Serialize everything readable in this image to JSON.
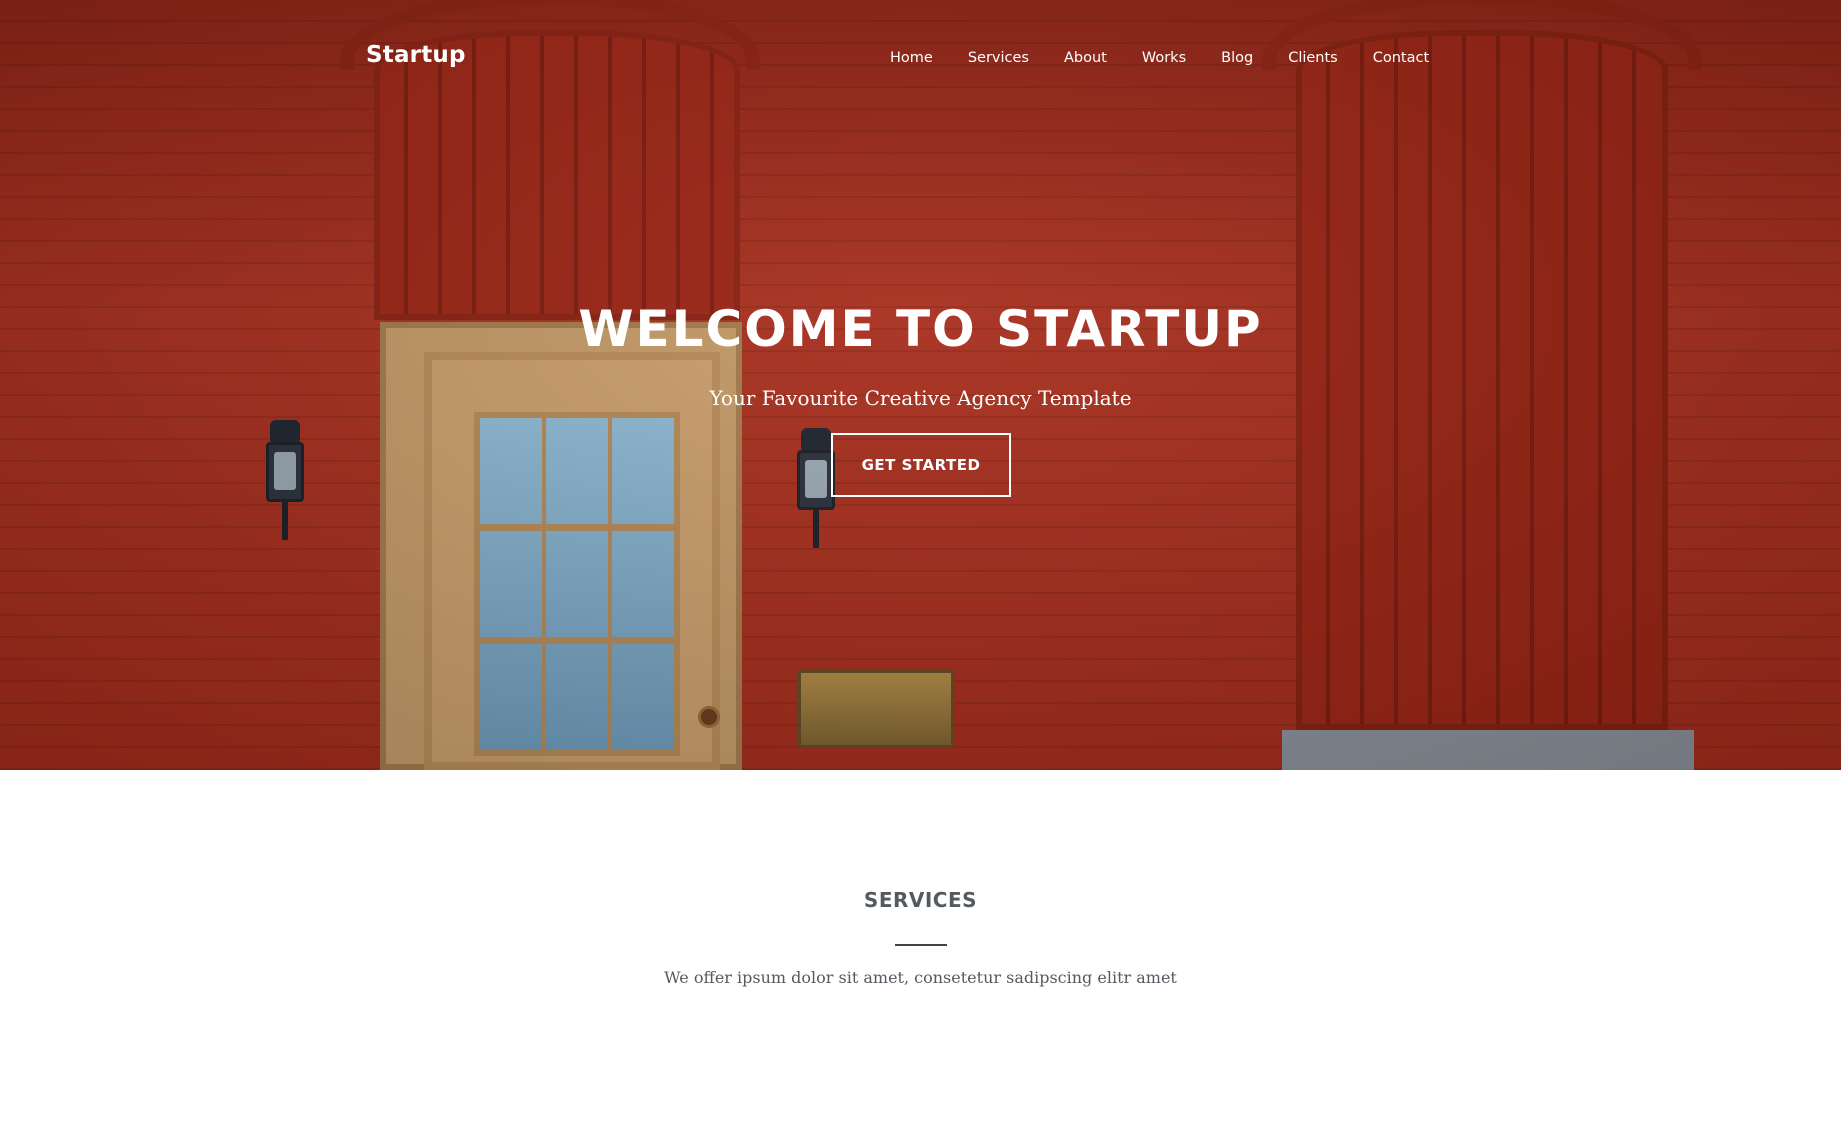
{
  "nav": {
    "brand": "Startup",
    "links": [
      "Home",
      "Services",
      "About",
      "Works",
      "Blog",
      "Clients",
      "Contact"
    ]
  },
  "hero": {
    "title": "WELCOME TO STARTUP",
    "subtitle": "Your Favourite Creative Agency Template",
    "button_label": "GET STARTED",
    "background_image": "red-brick-building-facade"
  },
  "services": {
    "title": "SERVICES",
    "description": "We offer ipsum dolor sit amet, consetetur sadipscing elitr amet"
  },
  "colors": {
    "hero_red": "#a32c1c",
    "text_white": "#ffffff",
    "section_heading": "#555a60"
  }
}
